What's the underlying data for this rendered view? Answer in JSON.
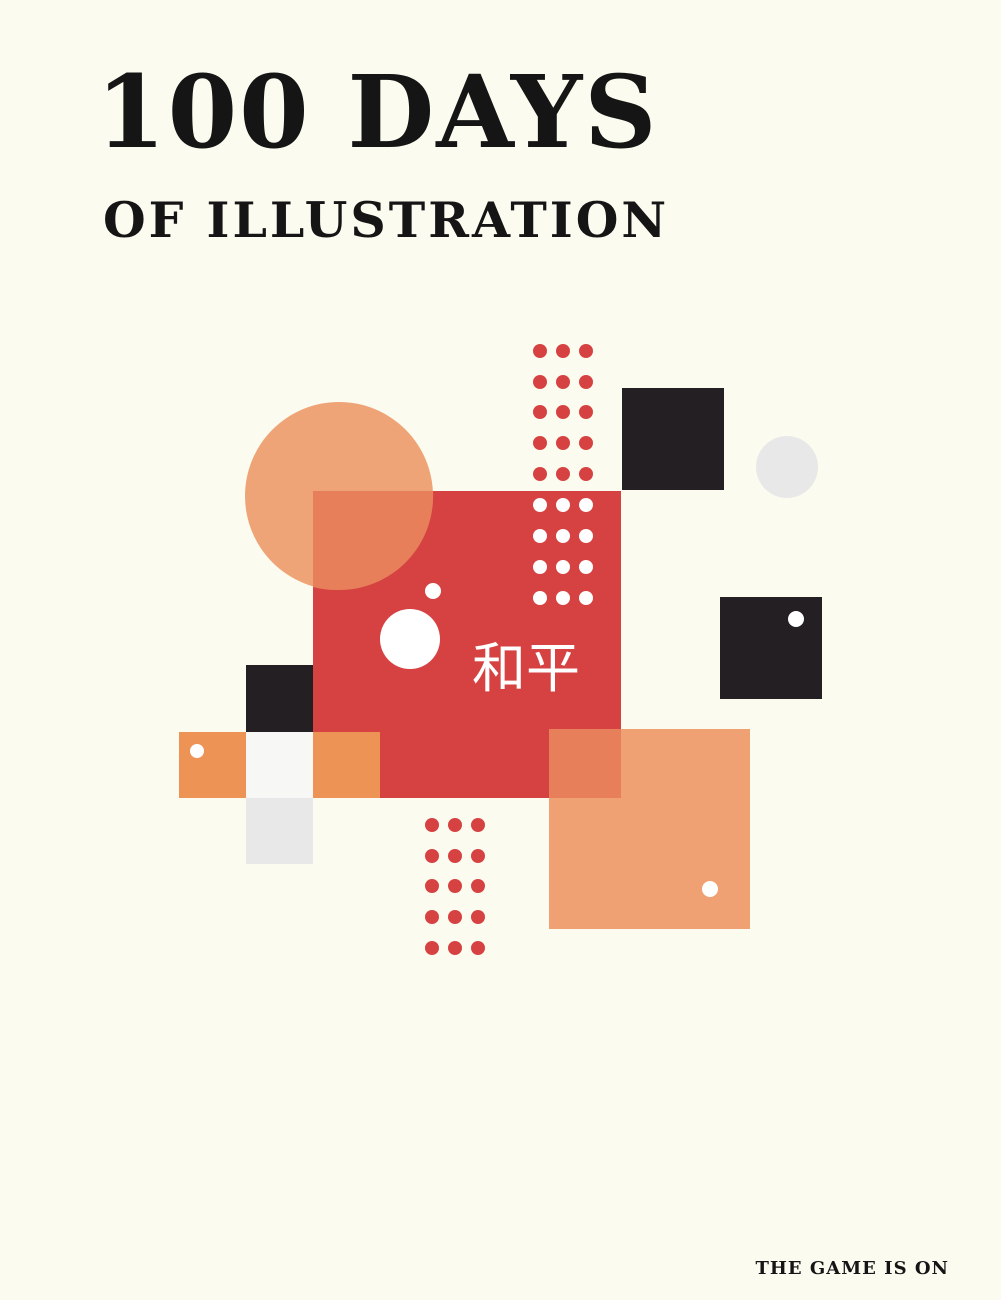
{
  "title": {
    "main": "100 DAYS",
    "sub": "OF ILLUSTRATION"
  },
  "artwork": {
    "kanji": "和平",
    "colors": {
      "background": "#fbfbef",
      "red": "#d64242",
      "orange": "#ee9c6c",
      "black": "#231f22",
      "light_gray": "#e8e8e8",
      "white": "#ffffff"
    }
  },
  "footer": {
    "tagline": "THE GAME IS ON"
  }
}
